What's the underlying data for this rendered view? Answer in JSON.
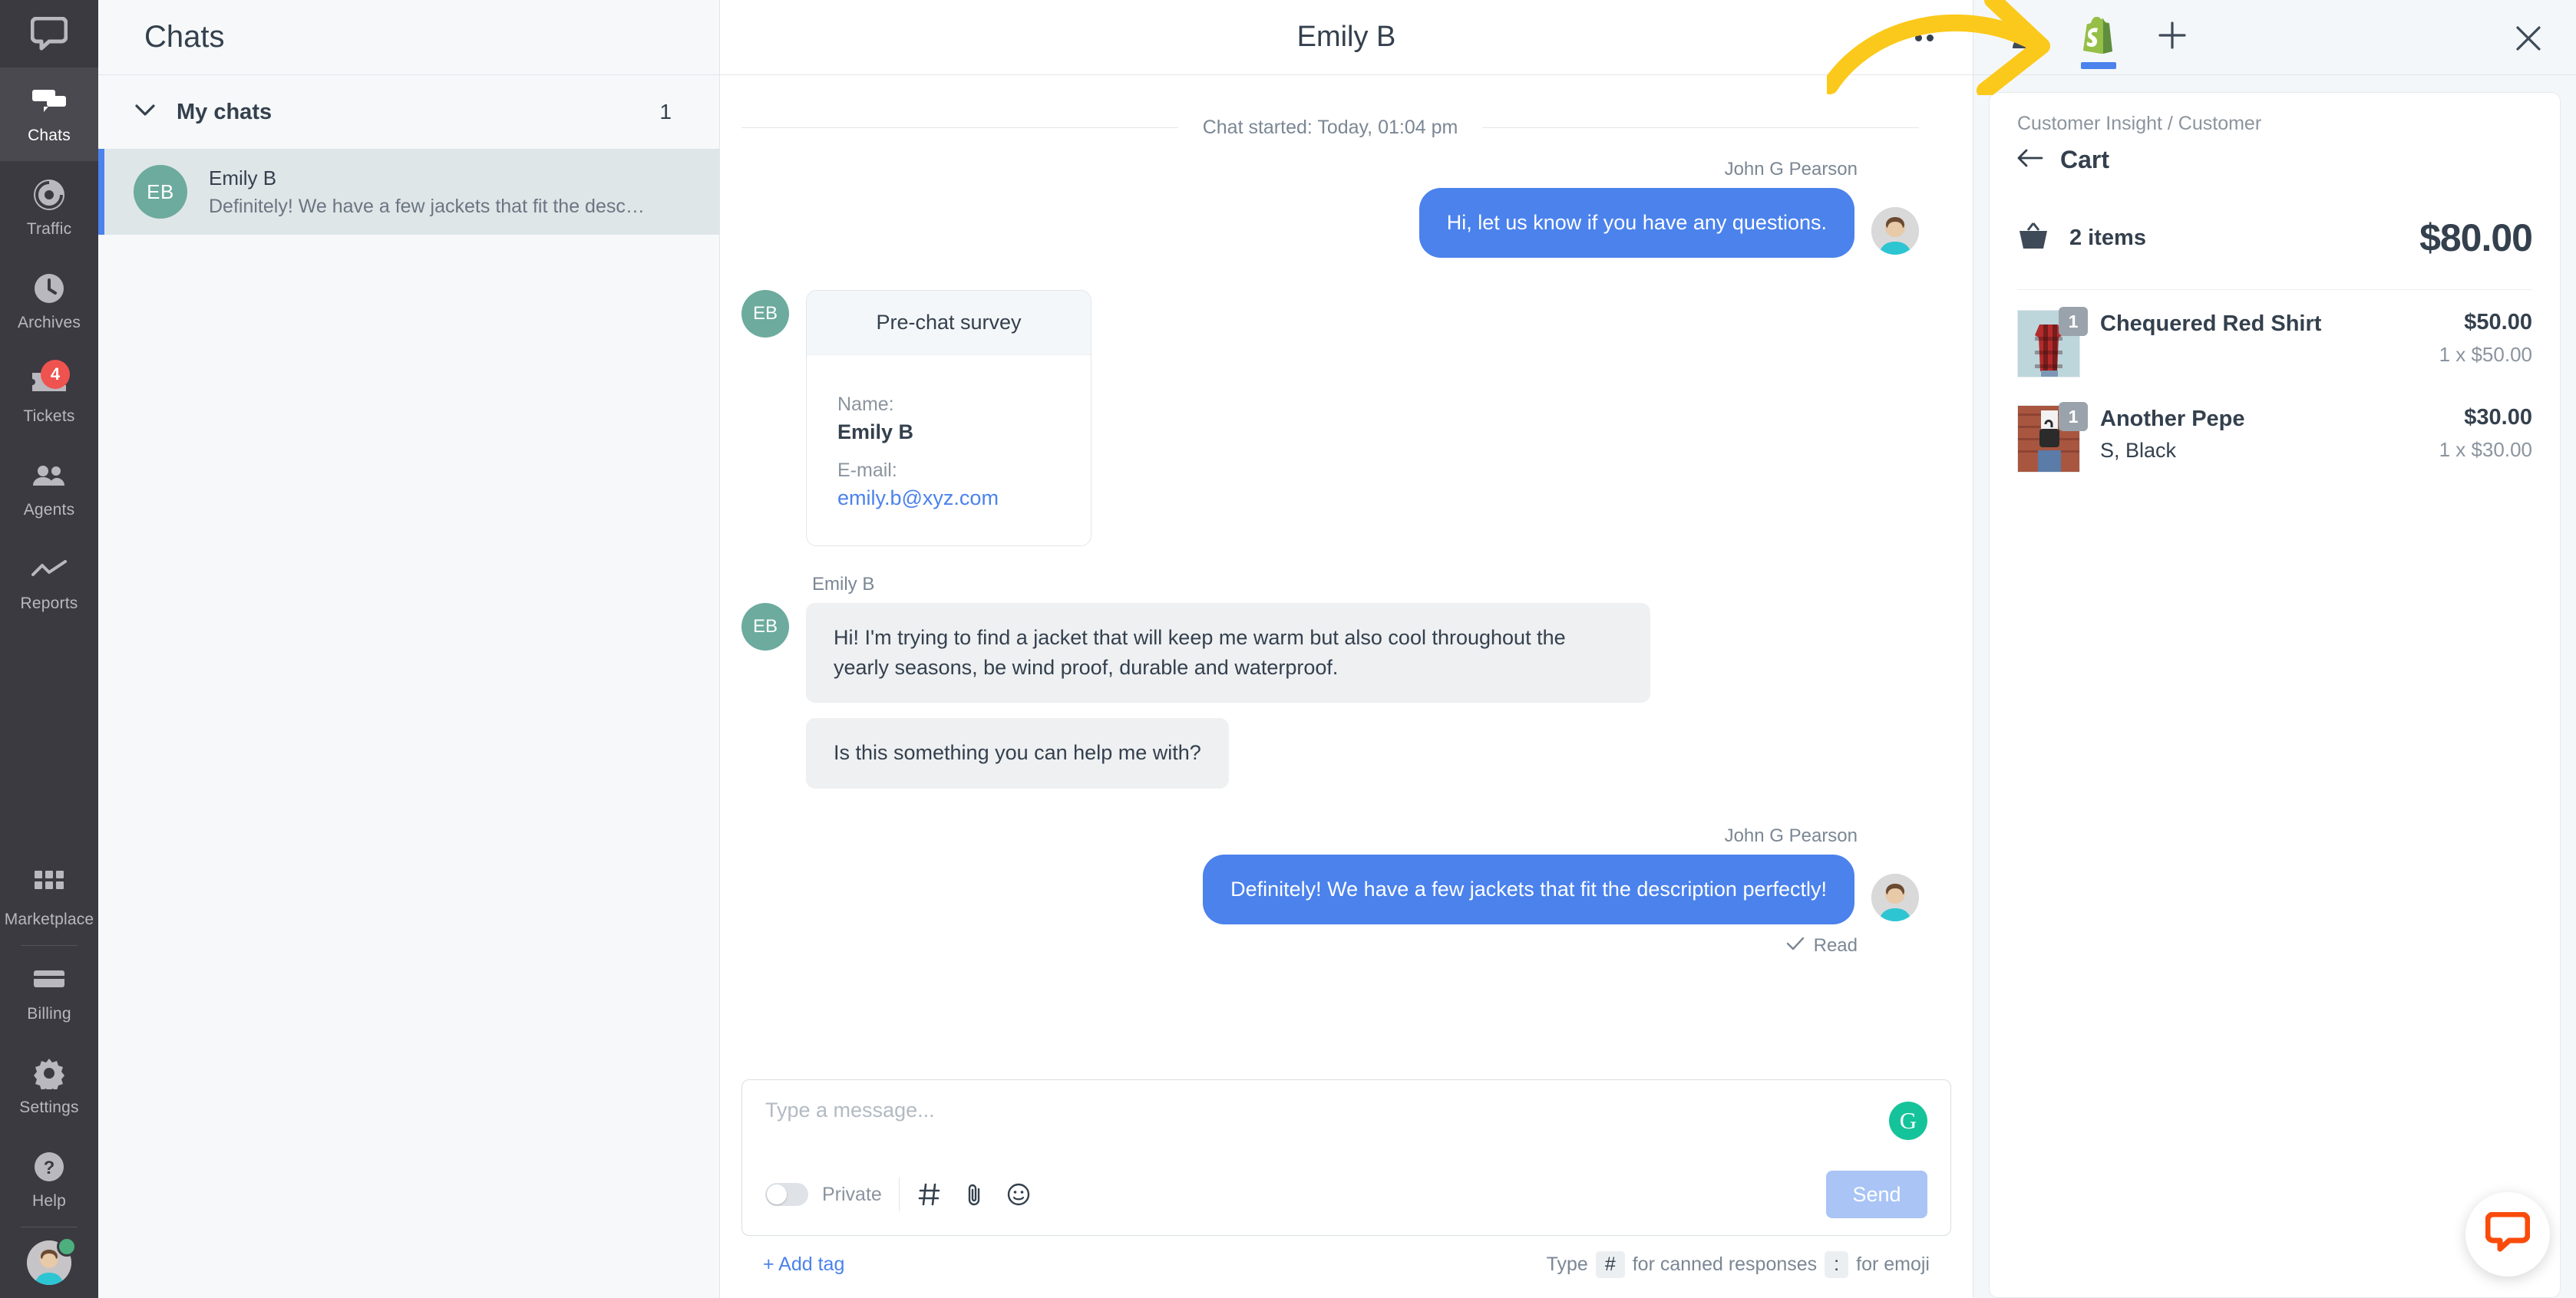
{
  "rail": {
    "logo_icon": "livechat-logo-icon",
    "items": [
      {
        "label": "Chats",
        "icon": "chats-icon",
        "active": true,
        "badge": ""
      },
      {
        "label": "Traffic",
        "icon": "traffic-icon",
        "active": false,
        "badge": ""
      },
      {
        "label": "Archives",
        "icon": "archives-icon",
        "active": false,
        "badge": ""
      },
      {
        "label": "Tickets",
        "icon": "tickets-icon",
        "active": false,
        "badge": "4"
      },
      {
        "label": "Agents",
        "icon": "agents-icon",
        "active": false,
        "badge": ""
      },
      {
        "label": "Reports",
        "icon": "reports-icon",
        "active": false,
        "badge": ""
      }
    ],
    "bottom_items": [
      {
        "label": "Marketplace",
        "icon": "marketplace-icon"
      },
      {
        "label": "Billing",
        "icon": "billing-icon"
      },
      {
        "label": "Settings",
        "icon": "settings-icon"
      },
      {
        "label": "Help",
        "icon": "help-icon"
      }
    ],
    "avatar_status": "online"
  },
  "chatlist": {
    "header_title": "Chats",
    "section": {
      "label": "My chats",
      "count": "1",
      "chevron_icon": "chevron-down-icon"
    },
    "items": [
      {
        "initials": "EB",
        "name": "Emily B",
        "snippet": "Definitely! We have a few jackets that fit the desc…"
      }
    ]
  },
  "conversation": {
    "title": "Emily B",
    "started": "Chat started: Today, 01:04 pm",
    "header_actions": [
      {
        "name": "more-options-icon",
        "label": "…"
      }
    ],
    "messages": [
      {
        "type": "agent",
        "sender": "John G Pearson",
        "text": "Hi, let us know if you have any questions."
      },
      {
        "type": "survey",
        "sender": "",
        "title": "Pre-chat survey",
        "initials": "EB",
        "fields": [
          {
            "label": "Name:",
            "value": "Emily B",
            "link": false
          },
          {
            "label": "E-mail:",
            "value": "emily.b@xyz.com",
            "link": true
          }
        ]
      },
      {
        "type": "customer",
        "sender": "Emily B",
        "initials": "EB",
        "text": "Hi! I'm trying to find a jacket that will keep me warm but also cool throughout the yearly seasons, be wind proof, durable and waterproof."
      },
      {
        "type": "customer",
        "sender": "",
        "initials": "",
        "text": "Is this something you can help me with?"
      },
      {
        "type": "agent",
        "sender": "John G Pearson",
        "text": "Definitely! We have a few jackets that fit the description perfectly!",
        "status": "Read",
        "status_icon": "check-icon"
      }
    ],
    "composer": {
      "placeholder": "Type a message...",
      "private_label": "Private",
      "canned_icon": "hash-icon",
      "attach_icon": "paperclip-icon",
      "emoji_icon": "emoji-icon",
      "grammarly_icon": "grammarly-icon",
      "send_label": "Send",
      "add_tag_label": "+ Add tag",
      "hint_prefix": "Type",
      "hint_kbd1": "#",
      "hint_mid": "for canned responses",
      "hint_kbd2": ":",
      "hint_suffix": "for emoji"
    }
  },
  "details": {
    "tabs": [
      {
        "name": "customer-details-tab",
        "icon": "person-icon",
        "active": false
      },
      {
        "name": "shopify-app-tab",
        "icon": "shopify-icon",
        "active": true
      },
      {
        "name": "add-app-tab",
        "icon": "plus-icon",
        "active": false
      }
    ],
    "close_icon": "close-icon",
    "breadcrumb": "Customer Insight / Customer",
    "back_icon": "arrow-left-icon",
    "panel_title": "Cart",
    "basket_icon": "basket-icon",
    "items_label": "2 items",
    "total": "$80.00",
    "products": [
      {
        "qty": "1",
        "name": "Chequered Red Shirt",
        "variant": "",
        "price": "$50.00",
        "unit": "1 x $50.00",
        "thumb": "shirt-photo"
      },
      {
        "qty": "1",
        "name": "Another Pepe",
        "variant": "S, Black",
        "price": "$30.00",
        "unit": "1 x $30.00",
        "thumb": "bag-photo"
      }
    ]
  },
  "widget": {
    "icon": "livechat-bubble-icon"
  },
  "annotation": {
    "type": "yellow-arrow",
    "color": "#fbc91b"
  },
  "colors": {
    "rail_bg": "#3b3a41",
    "accent_blue": "#4b82ec",
    "badge_red": "#ef5350",
    "avatar_green": "#6cab9e",
    "grammarly_green": "#15c39a",
    "widget_orange": "#fa4b0b",
    "shopify_green": "#95bf47"
  }
}
